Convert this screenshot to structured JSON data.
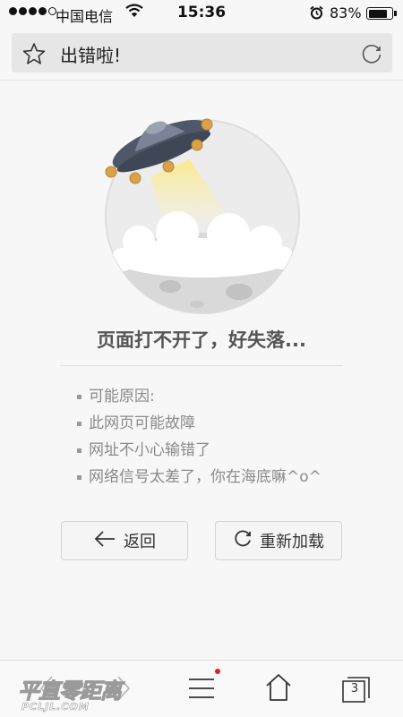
{
  "status_bar": {
    "carrier": "中国电信",
    "time": "15:36",
    "battery_percent": "83%",
    "battery_level": 0.83,
    "signal_bars_filled": 4,
    "signal_bars_total": 5
  },
  "address_bar": {
    "title": "出错啦!"
  },
  "error": {
    "heading": "页面打不开了，好失落...",
    "reasons": [
      "可能原因:",
      "此网页可能故障",
      "网址不小心输错了",
      "网络信号太差了，你在海底嘛^o^"
    ]
  },
  "buttons": {
    "back": "返回",
    "reload": "重新加载"
  },
  "bottom_bar": {
    "tab_count": "3"
  },
  "watermark": {
    "main": "平直零距离",
    "sub": "PCLJL.COM"
  },
  "colors": {
    "background": "#f7f7f7",
    "address_bar": "#e6e6e6",
    "notification_dot": "#e02020",
    "ufo_body": "#4f5868",
    "ufo_lights": "#d9a24a"
  }
}
